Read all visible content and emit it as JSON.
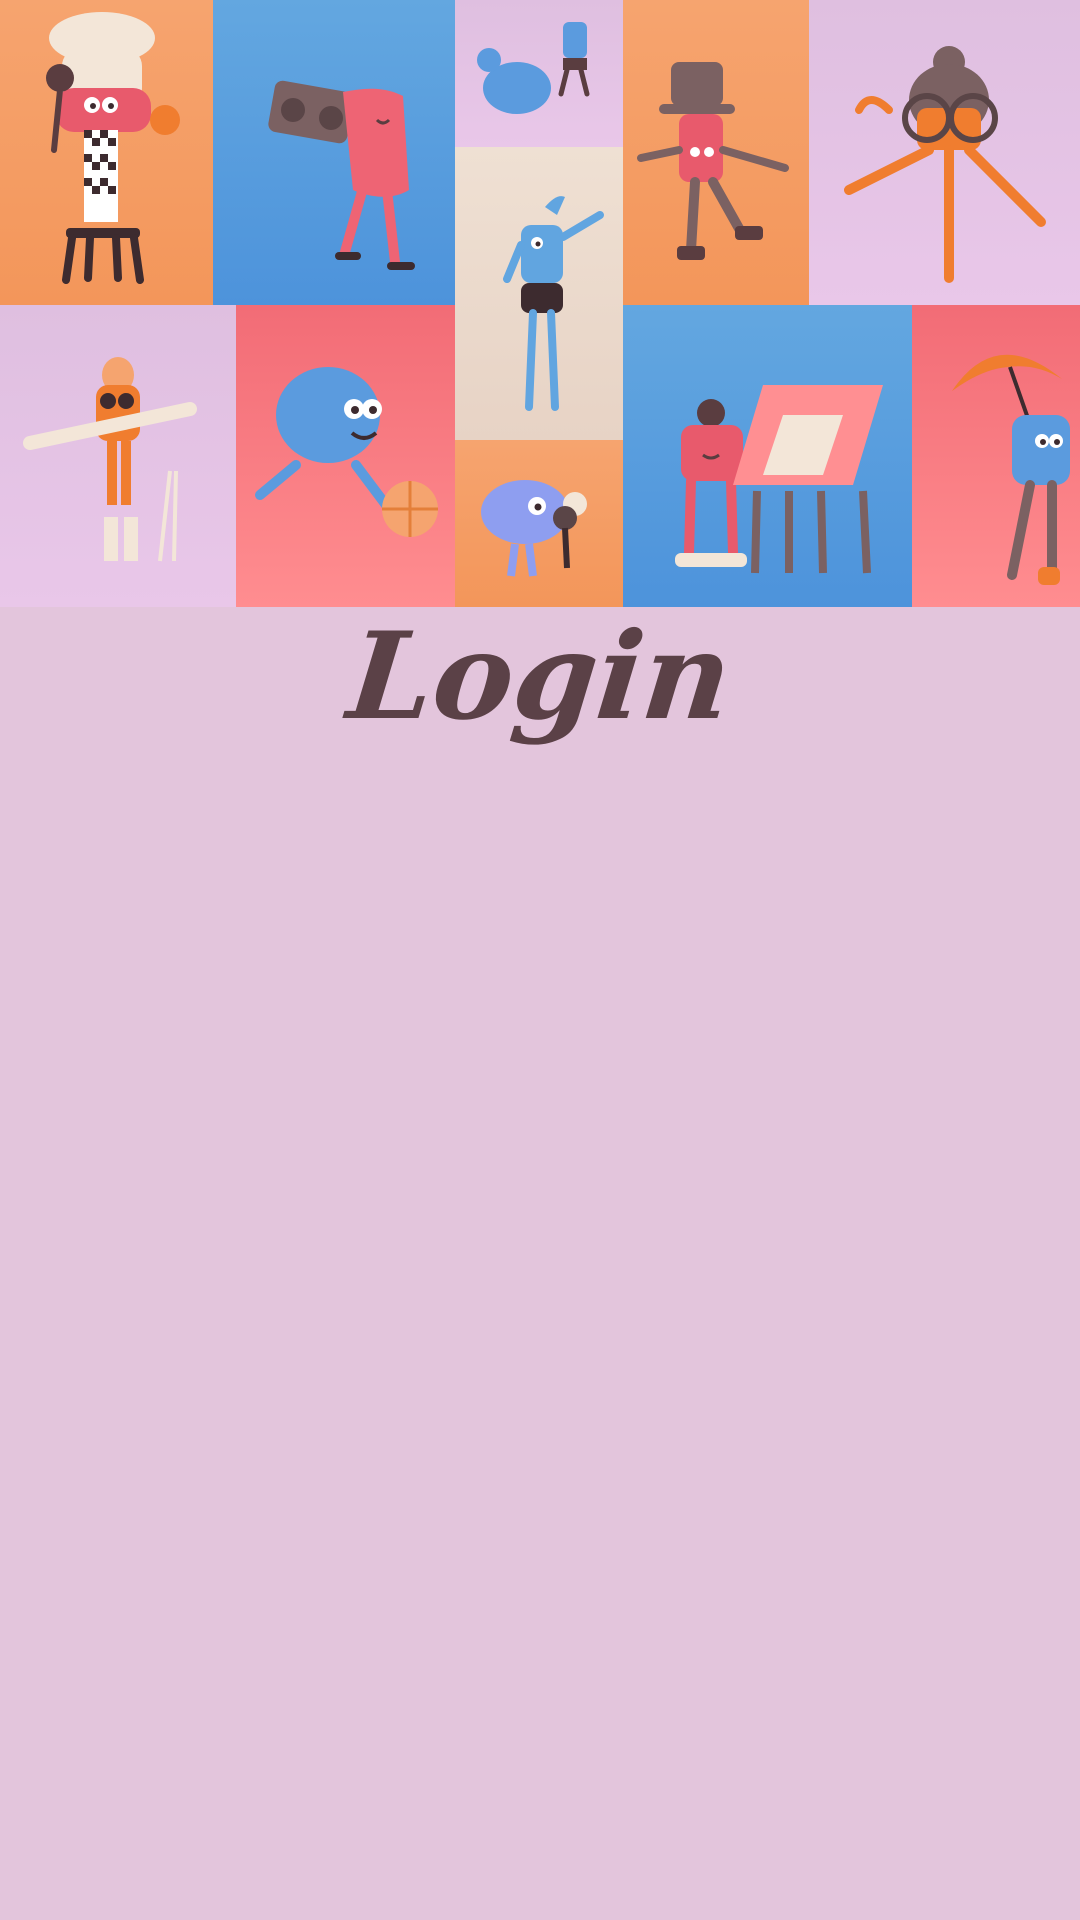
{
  "page": {
    "title": "Login",
    "background_color": "#e3c5dc",
    "title_color": "#5b4147"
  },
  "mosaic": {
    "tiles": [
      {
        "name": "chef-character-tile",
        "bg": "orange"
      },
      {
        "name": "boombox-character-tile",
        "bg": "blue"
      },
      {
        "name": "dog-walker-tile",
        "bg": "lilac"
      },
      {
        "name": "dancer-character-tile",
        "bg": "cream"
      },
      {
        "name": "roller-skater-tile",
        "bg": "orange"
      },
      {
        "name": "glasses-dancer-tile",
        "bg": "lilac"
      },
      {
        "name": "skier-character-tile",
        "bg": "lilac"
      },
      {
        "name": "basketball-player-tile",
        "bg": "red"
      },
      {
        "name": "bird-ice-cream-tile",
        "bg": "orange"
      },
      {
        "name": "artist-easel-tile",
        "bg": "blue"
      },
      {
        "name": "umbrella-character-tile",
        "bg": "red"
      }
    ]
  }
}
